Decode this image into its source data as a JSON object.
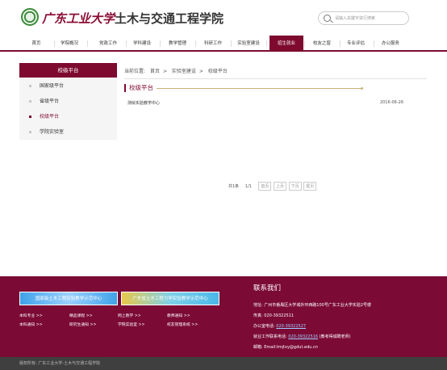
{
  "header": {
    "logo_univ": "广东工业大学",
    "logo_dept": "土木与交通工程学院",
    "search_placeholder": "请输入关键字进行搜索"
  },
  "nav": [
    "首页",
    "学院概况",
    "党政工作",
    "学科建设",
    "教学管理",
    "科研工作",
    "实验室建设",
    "招生就业",
    "校友之窗",
    "专业评估",
    "办公服务"
  ],
  "nav_active": 7,
  "sidebar": {
    "title": "校级平台",
    "items": [
      "国家级平台",
      "省级平台",
      "校级平台",
      "学院实验室"
    ],
    "active": 2
  },
  "breadcrumb": {
    "prefix": "当前位置:",
    "items": [
      "首页",
      "实验室建设",
      "校级平台"
    ]
  },
  "section_title": "校级平台",
  "articles": [
    {
      "title": "测绘实验教学中心",
      "date": "2016-06-26"
    }
  ],
  "pager": {
    "total": "共1条",
    "pages": "1/1",
    "buttons": [
      "首页",
      "上页",
      "下页",
      "尾页"
    ]
  },
  "footer": {
    "banners": [
      "国家级土木工程实验教学示范中心",
      "广东省土木工程力学实验教学示范中心"
    ],
    "links": [
      [
        "本科专业 >>",
        "精品课程 >>",
        "网上教学 >>",
        "教师通知 >>"
      ],
      [
        "本科通知 >>",
        "研究生通知 >>",
        "学院实验室 >>",
        "校友管理系统 >>"
      ]
    ],
    "contact_title": "联系我们",
    "address": "地址:  广州市番禺区大学城外环西路100号广东工业大学实验2号楼",
    "fax": "传真:  020-39322511",
    "office_label": "办公室电话:",
    "office_phone": "020-39322527",
    "job_label": "就业工作联系电话:",
    "job_phone": "020-39322516",
    "job_note": "(教考得诚聘老师)",
    "email": "邮箱:  Email:tmjtxy@gdut.edu.cn"
  },
  "copyright": "版权所有:  广东工业大学-土木与交通工程学院"
}
